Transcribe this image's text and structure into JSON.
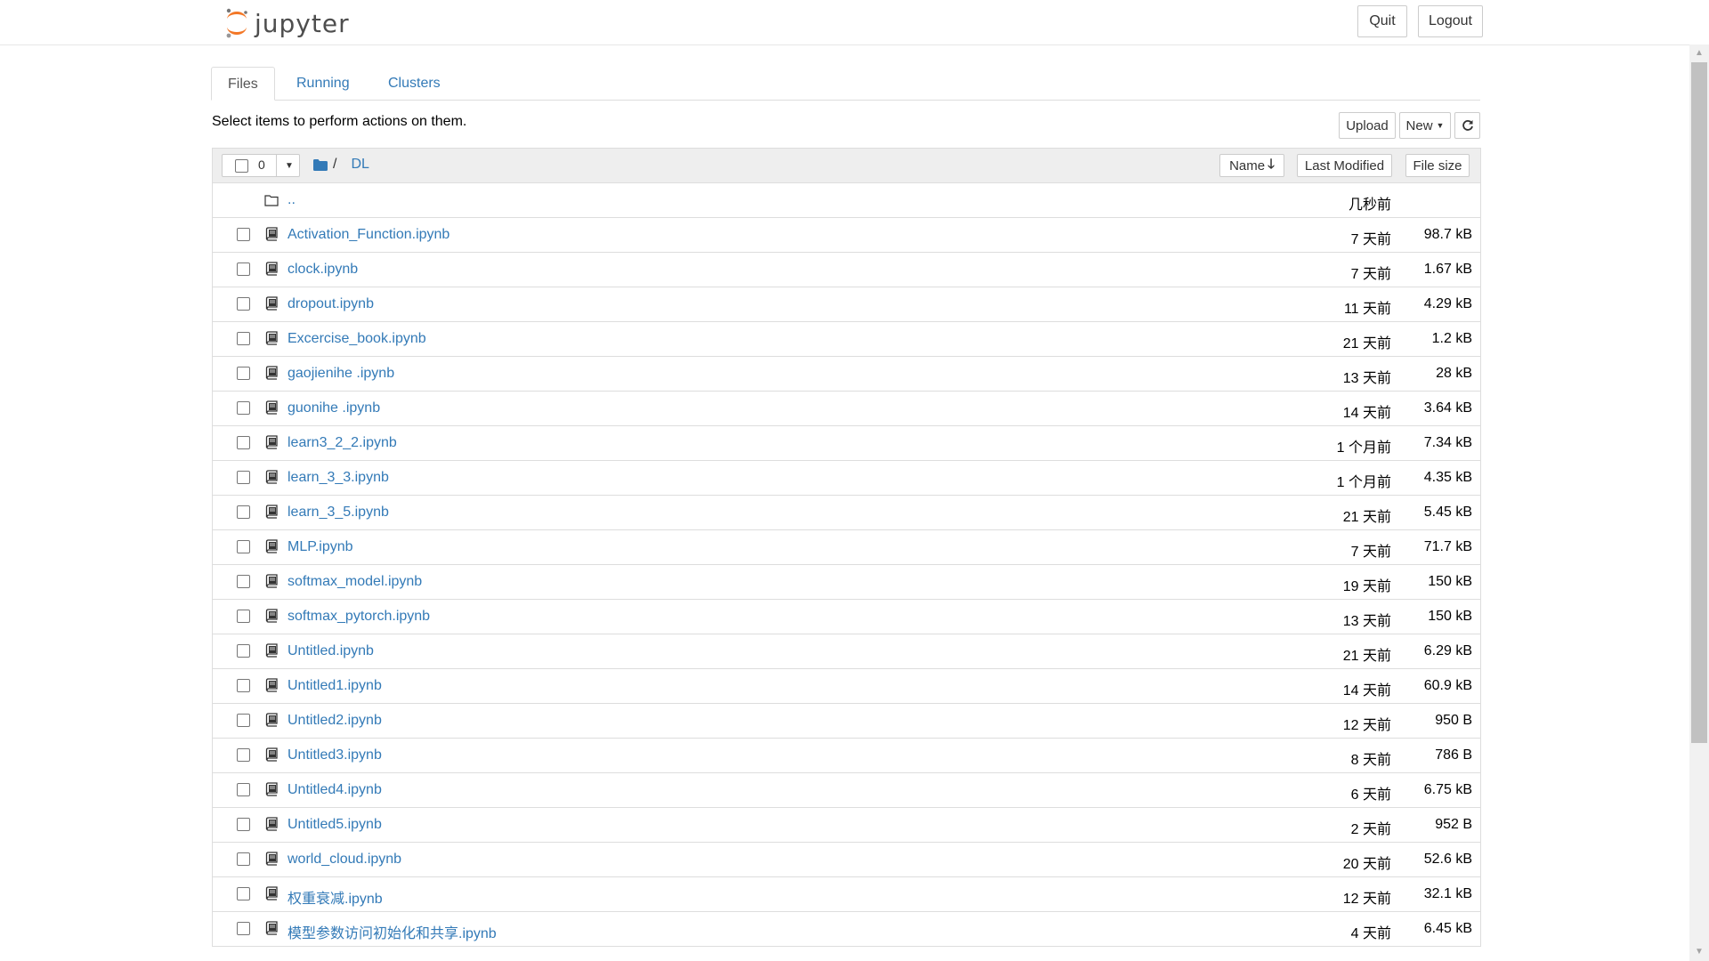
{
  "header": {
    "logo_text": "jupyter",
    "quit_label": "Quit",
    "logout_label": "Logout"
  },
  "tabs": [
    {
      "label": "Files",
      "active": true
    },
    {
      "label": "Running",
      "active": false
    },
    {
      "label": "Clusters",
      "active": false
    }
  ],
  "toolbar": {
    "instructions": "Select items to perform actions on them.",
    "upload_label": "Upload",
    "new_label": "New",
    "refresh_icon": "refresh-icon"
  },
  "list_header": {
    "selected_count": "0",
    "breadcrumb_sep": "/",
    "breadcrumb_dir": "DL",
    "sort_name_label": "Name",
    "sort_modified_label": "Last Modified",
    "sort_size_label": "File size"
  },
  "parent_row": {
    "name": "..",
    "modified": "几秒前"
  },
  "files": [
    {
      "name": "Activation_Function.ipynb",
      "modified": "7 天前",
      "size": "98.7 kB"
    },
    {
      "name": "clock.ipynb",
      "modified": "7 天前",
      "size": "1.67 kB"
    },
    {
      "name": "dropout.ipynb",
      "modified": "11 天前",
      "size": "4.29 kB"
    },
    {
      "name": "Excercise_book.ipynb",
      "modified": "21 天前",
      "size": "1.2 kB"
    },
    {
      "name": "gaojienihe .ipynb",
      "modified": "13 天前",
      "size": "28 kB"
    },
    {
      "name": "guonihe .ipynb",
      "modified": "14 天前",
      "size": "3.64 kB"
    },
    {
      "name": "learn3_2_2.ipynb",
      "modified": "1 个月前",
      "size": "7.34 kB"
    },
    {
      "name": "learn_3_3.ipynb",
      "modified": "1 个月前",
      "size": "4.35 kB"
    },
    {
      "name": "learn_3_5.ipynb",
      "modified": "21 天前",
      "size": "5.45 kB"
    },
    {
      "name": "MLP.ipynb",
      "modified": "7 天前",
      "size": "71.7 kB"
    },
    {
      "name": "softmax_model.ipynb",
      "modified": "19 天前",
      "size": "150 kB"
    },
    {
      "name": "softmax_pytorch.ipynb",
      "modified": "13 天前",
      "size": "150 kB"
    },
    {
      "name": "Untitled.ipynb",
      "modified": "21 天前",
      "size": "6.29 kB"
    },
    {
      "name": "Untitled1.ipynb",
      "modified": "14 天前",
      "size": "60.9 kB"
    },
    {
      "name": "Untitled2.ipynb",
      "modified": "12 天前",
      "size": "950 B"
    },
    {
      "name": "Untitled3.ipynb",
      "modified": "8 天前",
      "size": "786 B"
    },
    {
      "name": "Untitled4.ipynb",
      "modified": "6 天前",
      "size": "6.75 kB"
    },
    {
      "name": "Untitled5.ipynb",
      "modified": "2 天前",
      "size": "952 B"
    },
    {
      "name": "world_cloud.ipynb",
      "modified": "20 天前",
      "size": "52.6 kB"
    },
    {
      "name": "权重衰减.ipynb",
      "modified": "12 天前",
      "size": "32.1 kB"
    },
    {
      "name": "模型参数访问初始化和共享.ipynb",
      "modified": "4 天前",
      "size": "6.45 kB"
    }
  ],
  "colors": {
    "link": "#337ab7",
    "logo_orange": "#f37726",
    "header_bg": "#eeeeee",
    "border": "#dddddd"
  }
}
